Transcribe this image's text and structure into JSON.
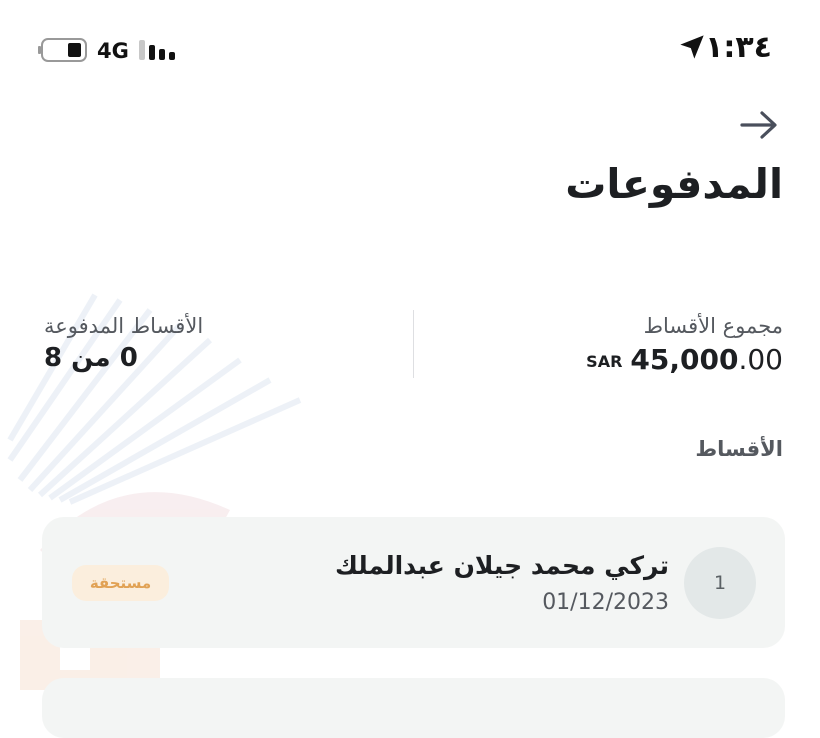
{
  "status_bar": {
    "time": "١:٣٤",
    "network": "4G",
    "icons": [
      "location-arrow-icon",
      "battery-icon",
      "signal-icon"
    ]
  },
  "header": {
    "back_icon": "arrow-right-icon",
    "title": "المدفوعات"
  },
  "summary": {
    "total_label": "مجموع الأقساط",
    "total_currency": "SAR",
    "total_amount": "45,000",
    "total_decimals": ".00",
    "paid_label": "الأقساط المدفوعة",
    "paid_value": "0 من 8"
  },
  "installments": {
    "section_title": "الأقساط",
    "items": [
      {
        "number": "1",
        "name": "تركي محمد جيلان عبدالملك",
        "date": "01/12/2023",
        "status": "مستحقة"
      }
    ]
  },
  "colors": {
    "badge_bg": "#fbeedd",
    "badge_text": "#e1a255",
    "card_bg": "#f3f5f4"
  }
}
